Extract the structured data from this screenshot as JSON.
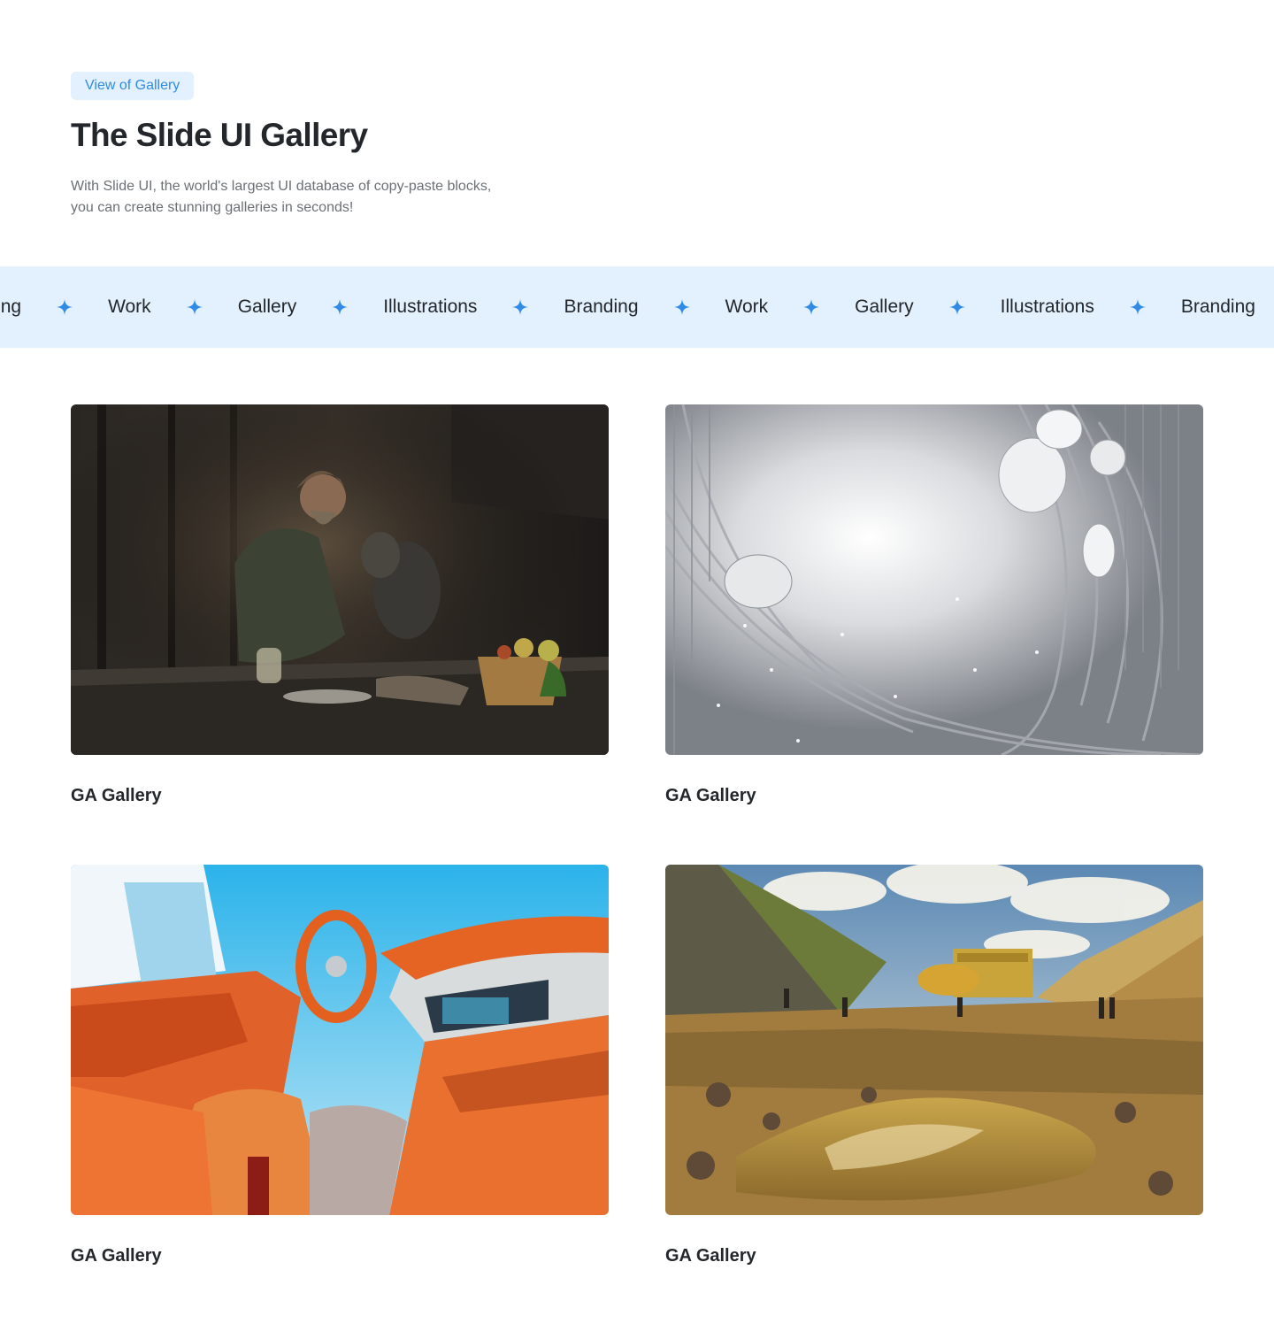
{
  "header": {
    "badge": "View of Gallery",
    "title": "The Slide UI Gallery",
    "description_line1": "With Slide UI, the world's largest UI database of copy-paste blocks,",
    "description_line2": "you can create stunning galleries in seconds!"
  },
  "marquee": {
    "items": [
      "Branding",
      "Work",
      "Gallery",
      "Illustrations",
      "Branding",
      "Work",
      "Gallery",
      "Illustrations",
      "Branding",
      "Work"
    ],
    "separator_icon": "sparkle-star-icon",
    "accent_color": "#2f8be6"
  },
  "gallery": {
    "cards": [
      {
        "title": "GA Gallery",
        "image": "man-with-dog-painting"
      },
      {
        "title": "GA Gallery",
        "image": "futuristic-white-tunnel"
      },
      {
        "title": "GA Gallery",
        "image": "orange-car-interior"
      },
      {
        "title": "GA Gallery",
        "image": "mining-landscape"
      }
    ]
  }
}
